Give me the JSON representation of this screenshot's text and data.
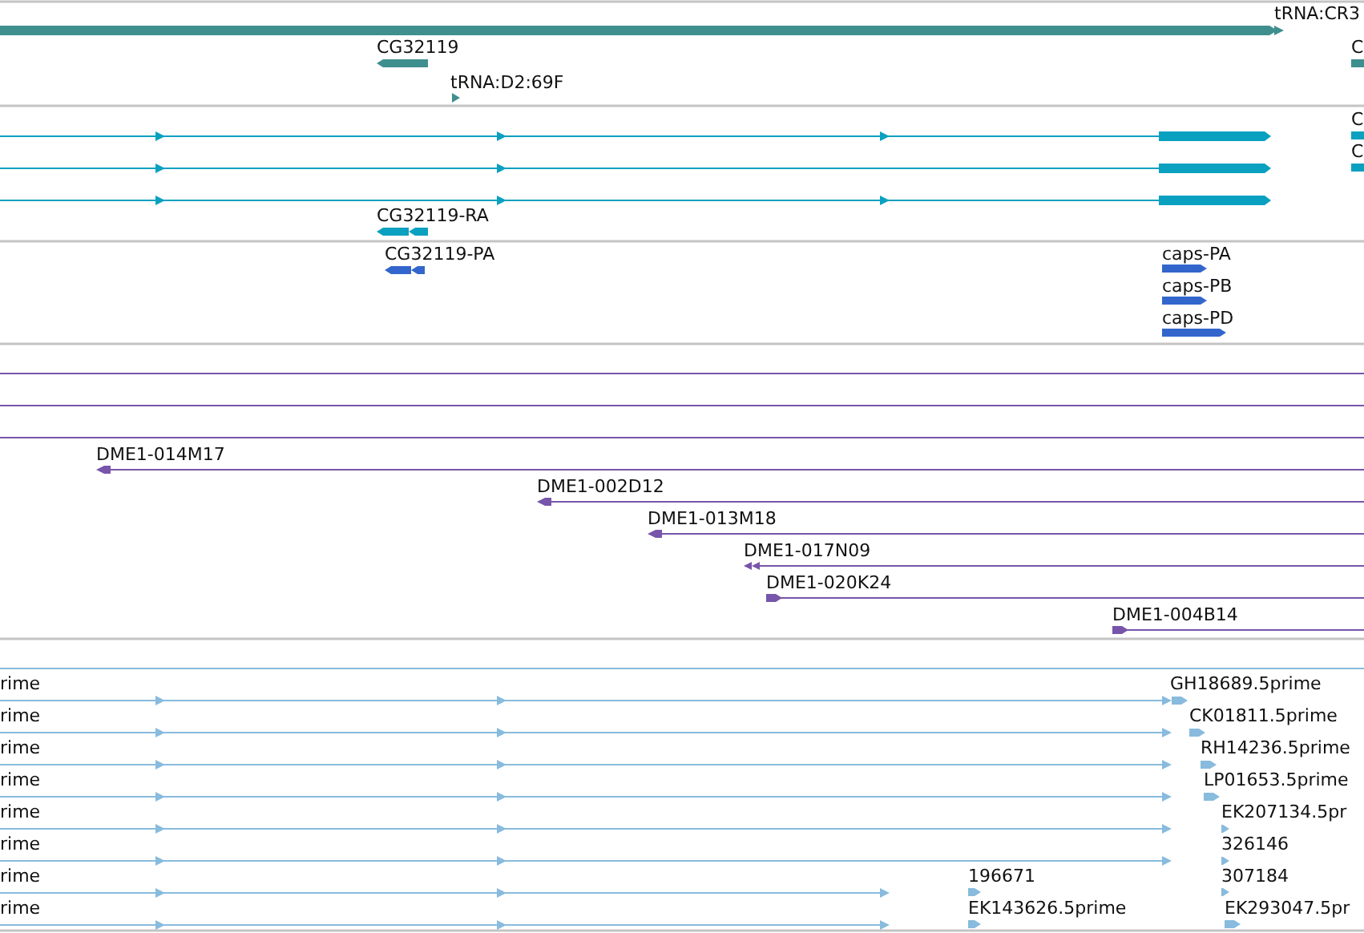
{
  "tracks": [
    {
      "kind": "gene",
      "features": [
        {
          "label": "tRNA:CR3"
        },
        {
          "label": "CG32119"
        },
        {
          "label": "tRNA:D2:69F"
        },
        {
          "label": "C"
        }
      ]
    },
    {
      "kind": "transcript",
      "features": [
        {
          "label": "C"
        },
        {
          "label": "C"
        },
        {
          "label": "CG32119-RA"
        }
      ]
    },
    {
      "kind": "protein",
      "features": [
        {
          "label": "CG32119-PA"
        },
        {
          "label": "caps-PA"
        },
        {
          "label": "caps-PB"
        },
        {
          "label": "caps-PD"
        }
      ]
    },
    {
      "kind": "clone",
      "features": [
        {
          "label": "DME1-014M17"
        },
        {
          "label": "DME1-002D12"
        },
        {
          "label": "DME1-013M18"
        },
        {
          "label": "DME1-017N09"
        },
        {
          "label": "DME1-020K24"
        },
        {
          "label": "DME1-004B14"
        }
      ]
    },
    {
      "kind": "est",
      "features": [
        {
          "label": "rime"
        },
        {
          "label": "GH18689.5prime"
        },
        {
          "label": "rime"
        },
        {
          "label": "CK01811.5prime"
        },
        {
          "label": "rime"
        },
        {
          "label": "RH14236.5prime"
        },
        {
          "label": "rime"
        },
        {
          "label": "LP01653.5prime"
        },
        {
          "label": "rime"
        },
        {
          "label": "EK207134.5pr"
        },
        {
          "label": "rime"
        },
        {
          "label": "326146"
        },
        {
          "label": "rime"
        },
        {
          "label": "196671"
        },
        {
          "label": "307184"
        },
        {
          "label": "rime"
        },
        {
          "label": "EK143626.5prime"
        },
        {
          "label": "EK293047.5pr"
        }
      ]
    }
  ]
}
